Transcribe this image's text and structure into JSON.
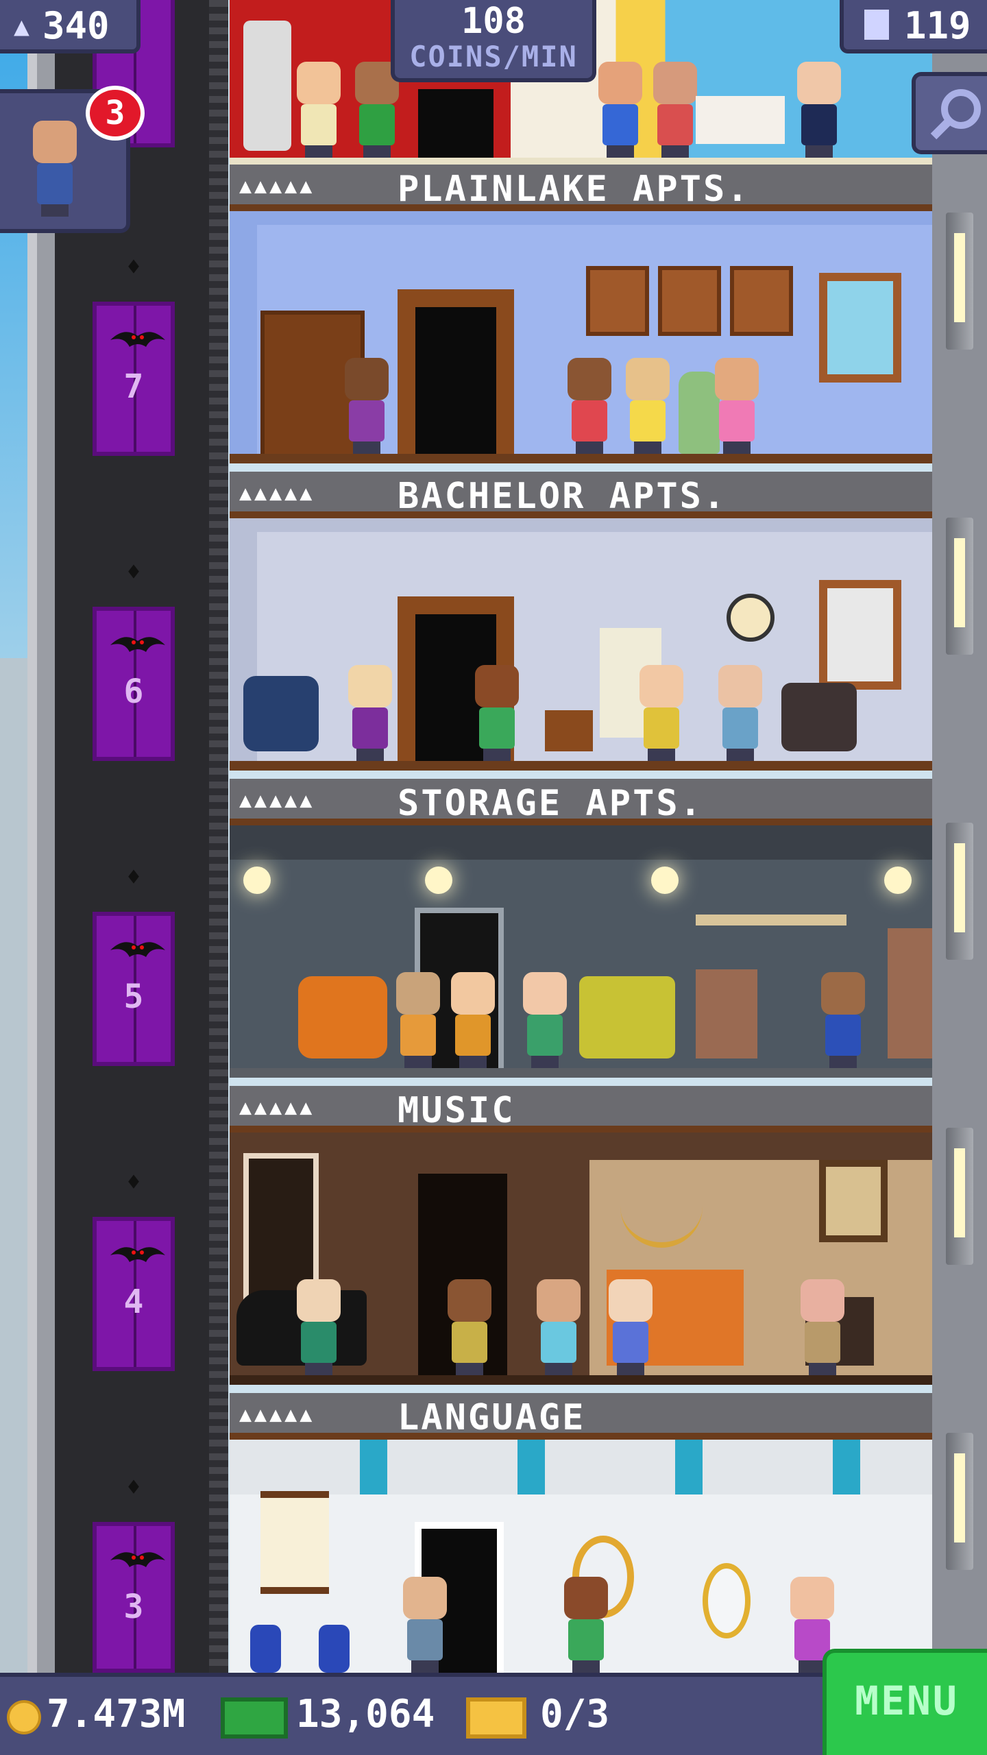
{
  "hud": {
    "population": "340",
    "coins_per_min_value": "108",
    "coins_per_min_label": "COINS/MIN",
    "floor_count": "119",
    "visitor_badge_count": "3"
  },
  "floors": [
    {
      "name": "PLAINLAKE APTS.",
      "stars": "▲▲▲▲▲"
    },
    {
      "name": "BACHELOR APTS.",
      "stars": "▲▲▲▲▲"
    },
    {
      "name": "STORAGE APTS.",
      "stars": "▲▲▲▲▲"
    },
    {
      "name": "MUSIC",
      "stars": "▲▲▲▲▲"
    },
    {
      "name": "LANGUAGE",
      "stars": "▲▲▲▲▲"
    }
  ],
  "elevator": {
    "floor_numbers": [
      "7",
      "6",
      "5",
      "4",
      "3"
    ]
  },
  "bottom_bar": {
    "coins": "7.473M",
    "bux": "13,064",
    "tickets": "0/3",
    "menu_label": "MENU"
  },
  "colors": {
    "hud_bg": "#4a4d7a",
    "elevator": "#7e16a8",
    "menu": "#2cc84c",
    "badge": "#e2182a"
  }
}
